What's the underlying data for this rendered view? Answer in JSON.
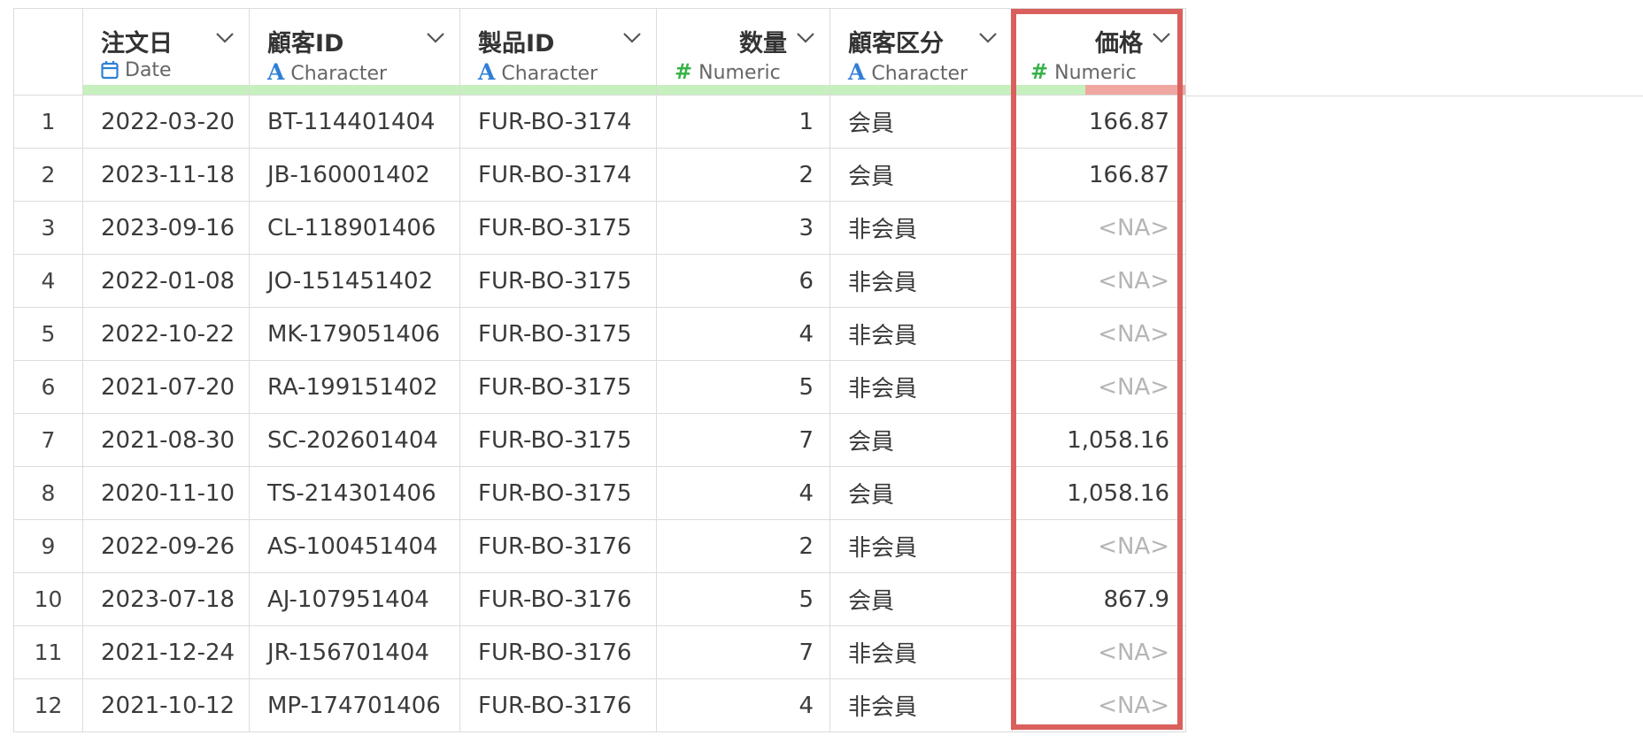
{
  "columns": [
    {
      "name": "注文日",
      "type": "Date",
      "icon": "calendar-icon",
      "align": "left"
    },
    {
      "name": "顧客ID",
      "type": "Character",
      "icon": "character-type-icon",
      "align": "left"
    },
    {
      "name": "製品ID",
      "type": "Character",
      "icon": "character-type-icon",
      "align": "left"
    },
    {
      "name": "数量",
      "type": "Numeric",
      "icon": "numeric-type-icon",
      "align": "right"
    },
    {
      "name": "顧客区分",
      "type": "Character",
      "icon": "character-type-icon",
      "align": "left"
    },
    {
      "name": "価格",
      "type": "Numeric",
      "icon": "numeric-type-icon",
      "align": "right",
      "missing_fraction": 0.58
    }
  ],
  "type_glyphs": {
    "character": "A",
    "numeric": "#"
  },
  "rows": [
    {
      "n": "1",
      "date": "2022-03-20",
      "cust": "BT-114401404",
      "prod": "FUR-BO-3174",
      "qty": "1",
      "seg": "会員",
      "price": "166.87"
    },
    {
      "n": "2",
      "date": "2023-11-18",
      "cust": "JB-160001402",
      "prod": "FUR-BO-3174",
      "qty": "2",
      "seg": "会員",
      "price": "166.87"
    },
    {
      "n": "3",
      "date": "2023-09-16",
      "cust": "CL-118901406",
      "prod": "FUR-BO-3175",
      "qty": "3",
      "seg": "非会員",
      "price": "<NA>"
    },
    {
      "n": "4",
      "date": "2022-01-08",
      "cust": "JO-151451402",
      "prod": "FUR-BO-3175",
      "qty": "6",
      "seg": "非会員",
      "price": "<NA>"
    },
    {
      "n": "5",
      "date": "2022-10-22",
      "cust": "MK-179051406",
      "prod": "FUR-BO-3175",
      "qty": "4",
      "seg": "非会員",
      "price": "<NA>"
    },
    {
      "n": "6",
      "date": "2021-07-20",
      "cust": "RA-199151402",
      "prod": "FUR-BO-3175",
      "qty": "5",
      "seg": "非会員",
      "price": "<NA>"
    },
    {
      "n": "7",
      "date": "2021-08-30",
      "cust": "SC-202601404",
      "prod": "FUR-BO-3175",
      "qty": "7",
      "seg": "会員",
      "price": "1,058.16"
    },
    {
      "n": "8",
      "date": "2020-11-10",
      "cust": "TS-214301406",
      "prod": "FUR-BO-3175",
      "qty": "4",
      "seg": "会員",
      "price": "1,058.16"
    },
    {
      "n": "9",
      "date": "2022-09-26",
      "cust": "AS-100451404",
      "prod": "FUR-BO-3176",
      "qty": "2",
      "seg": "非会員",
      "price": "<NA>"
    },
    {
      "n": "10",
      "date": "2023-07-18",
      "cust": "AJ-107951404",
      "prod": "FUR-BO-3176",
      "qty": "5",
      "seg": "会員",
      "price": "867.9"
    },
    {
      "n": "11",
      "date": "2021-12-24",
      "cust": "JR-156701404",
      "prod": "FUR-BO-3176",
      "qty": "7",
      "seg": "非会員",
      "price": "<NA>"
    },
    {
      "n": "12",
      "date": "2021-10-12",
      "cust": "MP-174701406",
      "prod": "FUR-BO-3176",
      "qty": "4",
      "seg": "非会員",
      "price": "<NA>"
    }
  ],
  "colors": {
    "valid_bar": "#c6f0bd",
    "missing_bar": "#f0a7a2",
    "highlight": "#d9605c",
    "na_text": "#b5b5b5"
  }
}
